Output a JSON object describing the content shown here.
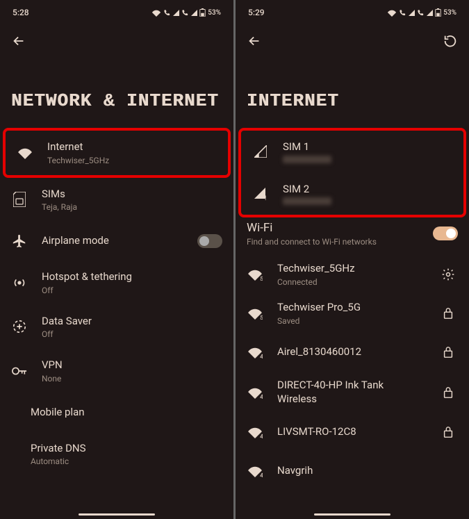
{
  "left": {
    "status": {
      "time": "5:28",
      "battery": "53%"
    },
    "title": "NETWORK & INTERNET",
    "rows": {
      "internet": {
        "title": "Internet",
        "sub": "Techwiser_5GHz"
      },
      "sims": {
        "title": "SIMs",
        "sub": "Teja, Raja"
      },
      "airplane": {
        "title": "Airplane mode"
      },
      "hotspot": {
        "title": "Hotspot & tethering",
        "sub": "Off"
      },
      "datasaver": {
        "title": "Data Saver",
        "sub": "Off"
      },
      "vpn": {
        "title": "VPN",
        "sub": "None"
      },
      "mobileplan": {
        "title": "Mobile plan"
      },
      "privatedns": {
        "title": "Private DNS",
        "sub": "Automatic"
      }
    }
  },
  "right": {
    "status": {
      "time": "5:29",
      "battery": "53%"
    },
    "title": "INTERNET",
    "sims": {
      "sim1": {
        "title": "SIM 1"
      },
      "sim2": {
        "title": "SIM 2"
      }
    },
    "wifi": {
      "label": "Wi-Fi",
      "sub": "Find and connect to Wi-Fi networks",
      "on": true
    },
    "networks": [
      {
        "name": "Techwiser_5GHz",
        "sub": "Connected",
        "action": "gear",
        "band": "5"
      },
      {
        "name": "Techwiser Pro_5G",
        "sub": "Saved",
        "action": "lock",
        "band": "5"
      },
      {
        "name": "Airel_8130460012",
        "action": "lock",
        "band": "4"
      },
      {
        "name": "DIRECT-40-HP Ink Tank Wireless",
        "action": "lock",
        "band": "4"
      },
      {
        "name": "LIVSMT-RO-12C8",
        "action": "lock",
        "band": "4"
      },
      {
        "name": "Navgrih",
        "band": "4"
      }
    ]
  }
}
